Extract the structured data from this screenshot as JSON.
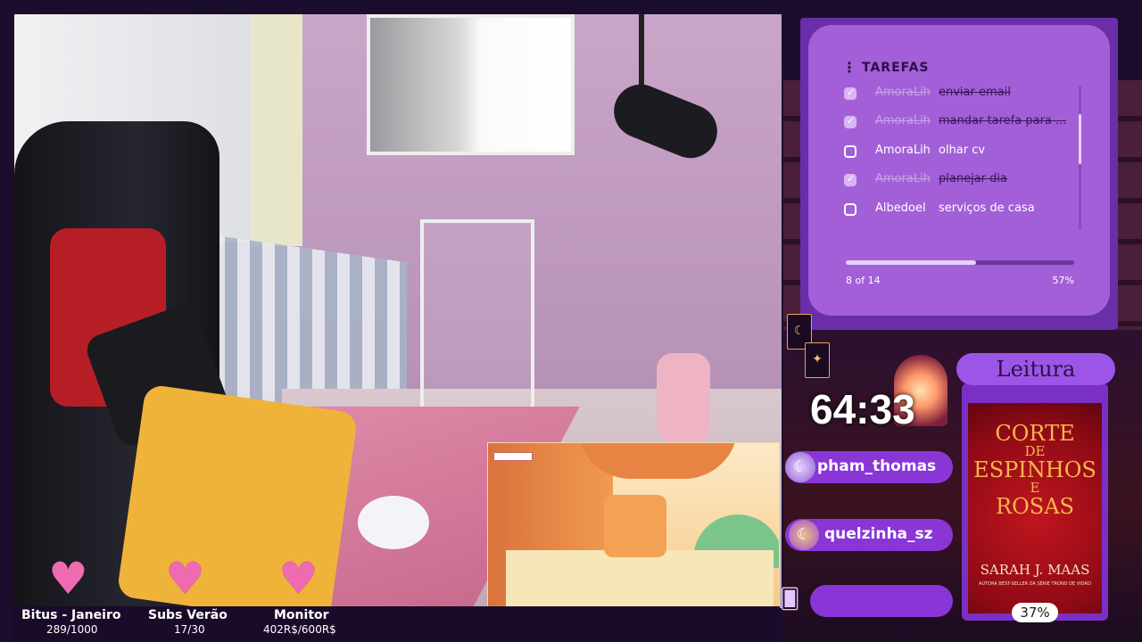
{
  "tasks": {
    "title": "TAREFAS",
    "items": [
      {
        "user": "AmoraLih",
        "text": "enviar email",
        "done": true
      },
      {
        "user": "AmoraLih",
        "text": "mandar tarefa para ...",
        "done": true
      },
      {
        "user": "AmoraLih",
        "text": "olhar cv",
        "done": false
      },
      {
        "user": "AmoraLih",
        "text": "planejar dia",
        "done": true
      },
      {
        "user": "Albedoel",
        "text": "serviços de casa",
        "done": false
      }
    ],
    "progress_label": "8 of 14",
    "progress_percent": "57%",
    "progress_fraction": 0.57
  },
  "timer": "64:33",
  "chat": {
    "users": [
      {
        "name": "pham_thomas",
        "icon": "crescent-moon-icon"
      },
      {
        "name": "quelzinha_sz",
        "icon": "crescent-moon-icon"
      }
    ],
    "bottom_icon": "tarot-cards-icon"
  },
  "reading": {
    "label": "Leitura",
    "book_title_1": "CORTE",
    "book_title_2": "DE",
    "book_title_3": "ESPINHOS",
    "book_title_4": "E",
    "book_title_5": "ROSAS",
    "author": "SARAH J. MAAS",
    "tagline": "AUTORA BEST-SELLER DA SÉRIE TRONO DE VIDRO",
    "progress": "37%"
  },
  "goals": [
    {
      "label": "Bitus - Janeiro",
      "value": "289/1000",
      "fill": 0.289
    },
    {
      "label": "Subs Verão",
      "value": "17/30",
      "fill": 0.567
    },
    {
      "label": "Monitor",
      "value": "402R$/600R$",
      "fill": 0.67
    }
  ],
  "colors": {
    "panel_purple": "#a35fd8",
    "accent_pink": "#f06ab2",
    "chat_pill": "#8a36d6"
  }
}
